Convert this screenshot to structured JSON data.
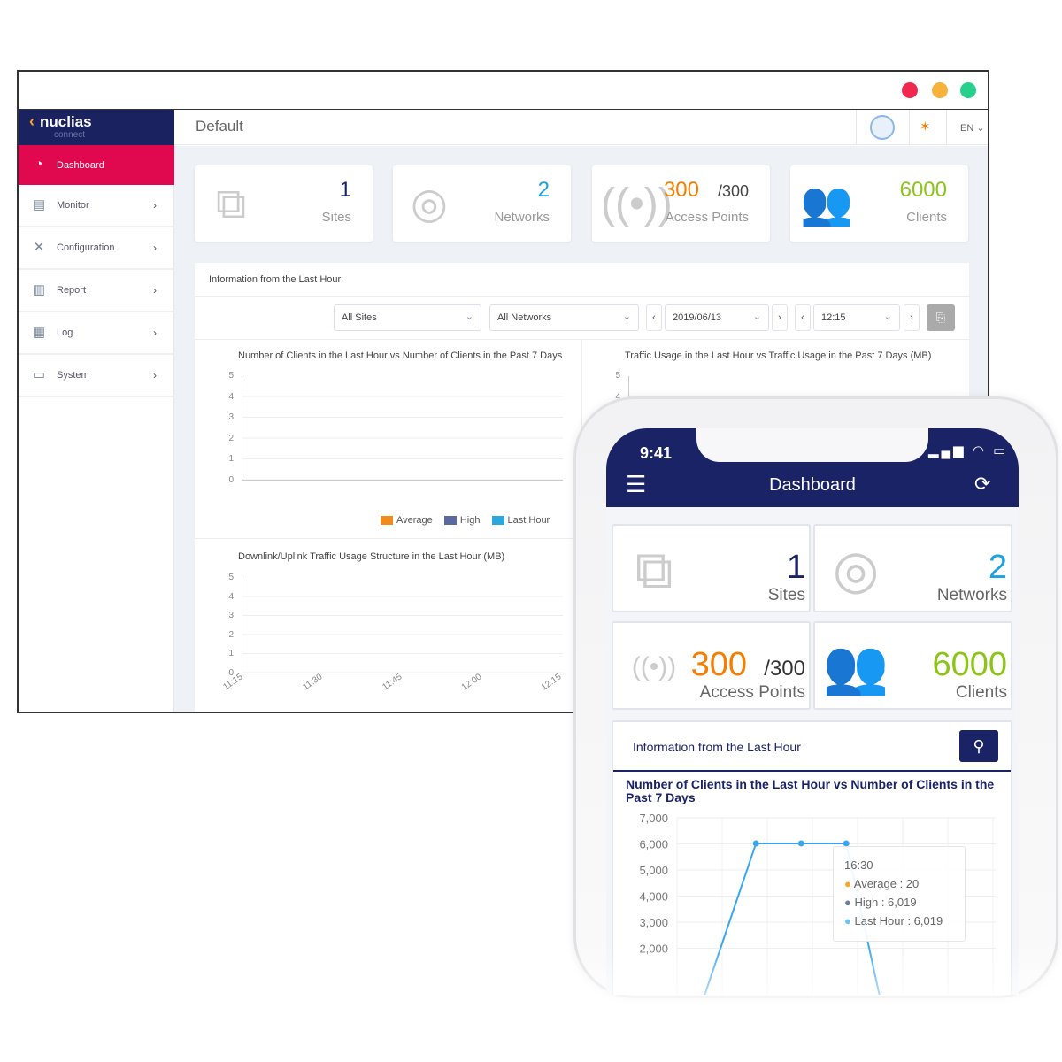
{
  "window": {
    "controls": {
      "close_color": "#f0284f",
      "minimize_color": "#f6b23a",
      "maximize_color": "#27d08c"
    }
  },
  "logo": {
    "name": "nuclias",
    "sub": "connect"
  },
  "sidebar": {
    "items": [
      {
        "label": "Dashboard",
        "icon": "dashboard-gauge-icon",
        "active": true
      },
      {
        "label": "Monitor",
        "icon": "monitor-icon"
      },
      {
        "label": "Configuration",
        "icon": "tools-icon"
      },
      {
        "label": "Report",
        "icon": "report-icon"
      },
      {
        "label": "Log",
        "icon": "log-icon"
      },
      {
        "label": "System",
        "icon": "system-icon"
      }
    ]
  },
  "header": {
    "title": "Default",
    "lang": "EN"
  },
  "cards": [
    {
      "value": "1",
      "label": "Sites",
      "color": "#1a2366"
    },
    {
      "value": "2",
      "label": "Networks",
      "color": "#1aa3e0"
    },
    {
      "value": "300",
      "total": "/300",
      "label": "Access Points",
      "color": "#f57d00"
    },
    {
      "value": "6000",
      "label": "Clients",
      "color": "#8cc418"
    }
  ],
  "panel": {
    "title": "Information from the Last Hour",
    "filters": {
      "site": "All Sites",
      "network": "All Networks",
      "date": "2019/06/13",
      "time": "12:15"
    },
    "charts": [
      {
        "title": "Number of Clients in the Last Hour vs Number of Clients in the Past 7 Days",
        "yticks": [
          "5",
          "4",
          "3",
          "2",
          "1",
          "0"
        ],
        "legend": [
          {
            "name": "Average",
            "color": "#f08c1c"
          },
          {
            "name": "High",
            "color": "#5a6aa0"
          },
          {
            "name": "Last Hour",
            "color": "#2aa8de"
          }
        ]
      },
      {
        "title": "Traffic Usage in the Last Hour vs Traffic Usage in the Past 7 Days (MB)",
        "yticks": [
          "5",
          "4"
        ]
      },
      {
        "title": "Downlink/Uplink Traffic Usage Structure in the Last Hour (MB)",
        "yticks": [
          "5",
          "4",
          "3",
          "2",
          "1",
          "0"
        ],
        "xticks": [
          "11:15",
          "11:30",
          "11:45",
          "12:00",
          "12:15"
        ]
      }
    ]
  },
  "phone": {
    "time": "9:41",
    "title": "Dashboard",
    "cards": [
      {
        "value": "1",
        "label": "Sites"
      },
      {
        "value": "2",
        "label": "Networks"
      },
      {
        "value": "300",
        "total": "/300",
        "label": "Access Points"
      },
      {
        "value": "6000",
        "label": "Clients"
      }
    ],
    "info_title": "Information from the Last Hour",
    "chart_title": "Number of Clients in the Last Hour vs Number of Clients in the Past 7 Days",
    "tooltip": {
      "time": "16:30",
      "rows": [
        {
          "text": "Average : 20",
          "color": "#f5a623"
        },
        {
          "text": "High : 6,019",
          "color": "#6d7fa0"
        },
        {
          "text": "Last Hour : 6,019",
          "color": "#6cc3f0"
        }
      ]
    }
  },
  "chart_data": {
    "type": "line",
    "yticks": [
      "7,000",
      "6,000",
      "5,000",
      "4,000",
      "3,000",
      "2,000"
    ],
    "ylim": [
      2000,
      7000
    ],
    "series": [
      {
        "name": "Last Hour",
        "color": "#3aa6ef",
        "values": [
          2000,
          6019,
          6019,
          6019,
          2000
        ]
      }
    ]
  }
}
